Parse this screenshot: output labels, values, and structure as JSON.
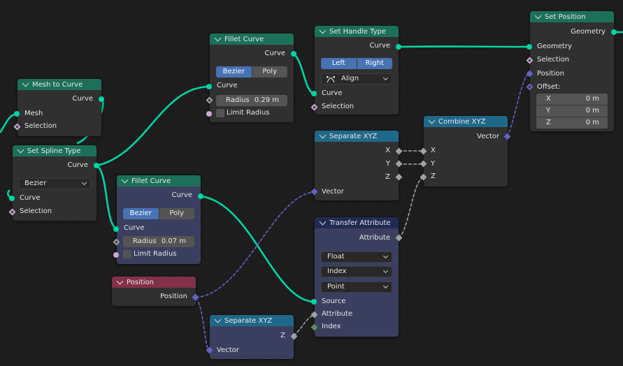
{
  "editor": "Geometry Node Editor",
  "nodes": {
    "mesh_to_curve": {
      "title": "Mesh to Curve",
      "outputs": [
        "Curve"
      ],
      "inputs": [
        "Mesh",
        "Selection"
      ]
    },
    "set_spline_type": {
      "title": "Set Spline Type",
      "outputs": [
        "Curve"
      ],
      "spline_type": "Bezier",
      "inputs": [
        "Curve",
        "Selection"
      ]
    },
    "fillet_curve_1": {
      "title": "Fillet Curve",
      "outputs": [
        "Curve"
      ],
      "modes": [
        "Bezier",
        "Poly"
      ],
      "active_mode": "Bezier",
      "inputs": [
        "Curve"
      ],
      "radius_label": "Radius",
      "radius_value": "0.29 m",
      "limit_radius_label": "Limit Radius",
      "limit_radius_checked": false
    },
    "fillet_curve_2": {
      "title": "Fillet Curve",
      "outputs": [
        "Curve"
      ],
      "modes": [
        "Bezier",
        "Poly"
      ],
      "active_mode": "Bezier",
      "inputs": [
        "Curve"
      ],
      "radius_label": "Radius",
      "radius_value": "0.07 m",
      "limit_radius_label": "Limit Radius",
      "limit_radius_checked": false
    },
    "set_handle_type": {
      "title": "Set Handle Type",
      "outputs": [
        "Curve"
      ],
      "sides": [
        "Left",
        "Right"
      ],
      "handle_type": "Align",
      "handle_icon": "handle-align-icon",
      "inputs": [
        "Curve",
        "Selection"
      ]
    },
    "set_position": {
      "title": "Set Position",
      "outputs": [
        "Geometry"
      ],
      "inputs": [
        "Geometry",
        "Selection",
        "Position",
        "Offset:"
      ],
      "offset": [
        {
          "axis": "X",
          "value": "0 m"
        },
        {
          "axis": "Y",
          "value": "0 m"
        },
        {
          "axis": "Z",
          "value": "0 m"
        }
      ]
    },
    "separate_xyz_1": {
      "title": "Separate XYZ",
      "outputs": [
        "X",
        "Y",
        "Z"
      ],
      "inputs": [
        "Vector"
      ]
    },
    "combine_xyz": {
      "title": "Combine XYZ",
      "outputs": [
        "Vector"
      ],
      "inputs": [
        "X",
        "Y",
        "Z"
      ]
    },
    "transfer_attribute": {
      "title": "Transfer Attribute",
      "outputs": [
        "Attribute"
      ],
      "data_type": "Float",
      "mapping": "Index",
      "domain": "Point",
      "inputs": [
        "Source",
        "Attribute",
        "Index"
      ]
    },
    "position": {
      "title": "Position",
      "outputs": [
        "Position"
      ]
    },
    "separate_xyz_2": {
      "title": "Separate XYZ",
      "outputs": [
        "Z"
      ],
      "inputs": [
        "Vector"
      ]
    }
  },
  "colors": {
    "geometry_link": "#00d6a3",
    "vector_link": "#6363c7",
    "float_link": "#a1a1a1",
    "header_geometry": "#1c705a",
    "header_vector": "#206889",
    "header_input": "#83314a",
    "header_attribute": "#1f2b52",
    "active_option": "#4772b3"
  }
}
